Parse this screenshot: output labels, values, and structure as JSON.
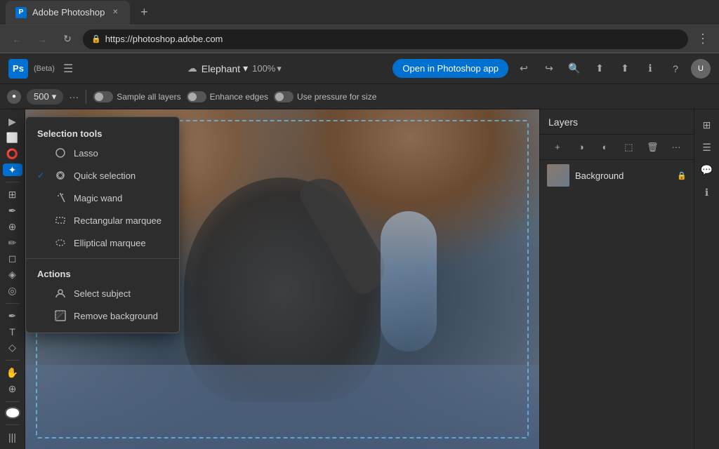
{
  "browser": {
    "tab_favicon": "P",
    "tab_title": "Adobe Photoshop",
    "new_tab_label": "+",
    "nav_back": "←",
    "nav_forward": "→",
    "nav_refresh": "↻",
    "address": "https://photoshop.adobe.com",
    "more_options": "⋮"
  },
  "app_header": {
    "logo_text": "Ps",
    "beta_label": "(Beta)",
    "hamburger_label": "☰",
    "cloud_label": "☁",
    "file_name": "Elephant",
    "file_chevron": "▾",
    "zoom_level": "100%",
    "zoom_chevron": "▾",
    "open_in_ps_label": "Open in Photoshop app",
    "undo_icon": "↩",
    "redo_icon": "↪",
    "search_icon": "🔍",
    "upload_icon": "⬆",
    "share_icon": "⬆",
    "info_icon": "ℹ",
    "help_icon": "?",
    "avatar_initials": "U"
  },
  "toolbar": {
    "toggle_label": "●",
    "brush_size": "500",
    "brush_chevron": "▾",
    "more_label": "···",
    "sample_all_layers_label": "Sample all layers",
    "enhance_edges_label": "Enhance edges",
    "pressure_label": "Use pressure for size"
  },
  "left_tools": {
    "select_tool": "▶",
    "marquee_tool": "⬜",
    "lasso_tool": "⭕",
    "magic_wand": "✦",
    "crop_tool": "⊞",
    "eye_dropper": "✒",
    "heal_tool": "⊕",
    "brush_tool": "✏",
    "eraser_tool": "◻",
    "gradient_tool": "◈",
    "blur_tool": "◎",
    "pen_tool": "✒",
    "type_tool": "T",
    "shape_tool": "◇",
    "hand_tool": "✋",
    "zoom_tool": "⊕",
    "fg_color": "white",
    "adjust_icon": "|||"
  },
  "selection_menu": {
    "section_title": "Selection tools",
    "items": [
      {
        "id": "lasso",
        "label": "Lasso",
        "icon": "⭕",
        "checked": false
      },
      {
        "id": "quick-selection",
        "label": "Quick selection",
        "icon": "✦",
        "checked": true
      },
      {
        "id": "magic-wand",
        "label": "Magic wand",
        "icon": "✦",
        "checked": false
      },
      {
        "id": "rectangular-marquee",
        "label": "Rectangular marquee",
        "icon": "⬜",
        "checked": false
      },
      {
        "id": "elliptical-marquee",
        "label": "Elliptical marquee",
        "icon": "⭕",
        "checked": false
      }
    ],
    "actions_title": "Actions",
    "actions": [
      {
        "id": "select-subject",
        "label": "Select subject",
        "icon": "👤"
      },
      {
        "id": "remove-background",
        "label": "Remove background",
        "icon": "🖼"
      }
    ]
  },
  "layers_panel": {
    "title": "Layers",
    "add_icon": "+",
    "mask_icon": "◑",
    "adjustment_icon": "◐",
    "effects_icon": "⬚",
    "delete_icon": "🗑",
    "more_icon": "···",
    "layers": [
      {
        "id": "background",
        "name": "Background",
        "locked": true
      }
    ]
  },
  "right_icons": {
    "layers_icon": "⊞",
    "adjustments_icon": "☰",
    "comments_icon": "💬",
    "info_icon": "ℹ"
  }
}
